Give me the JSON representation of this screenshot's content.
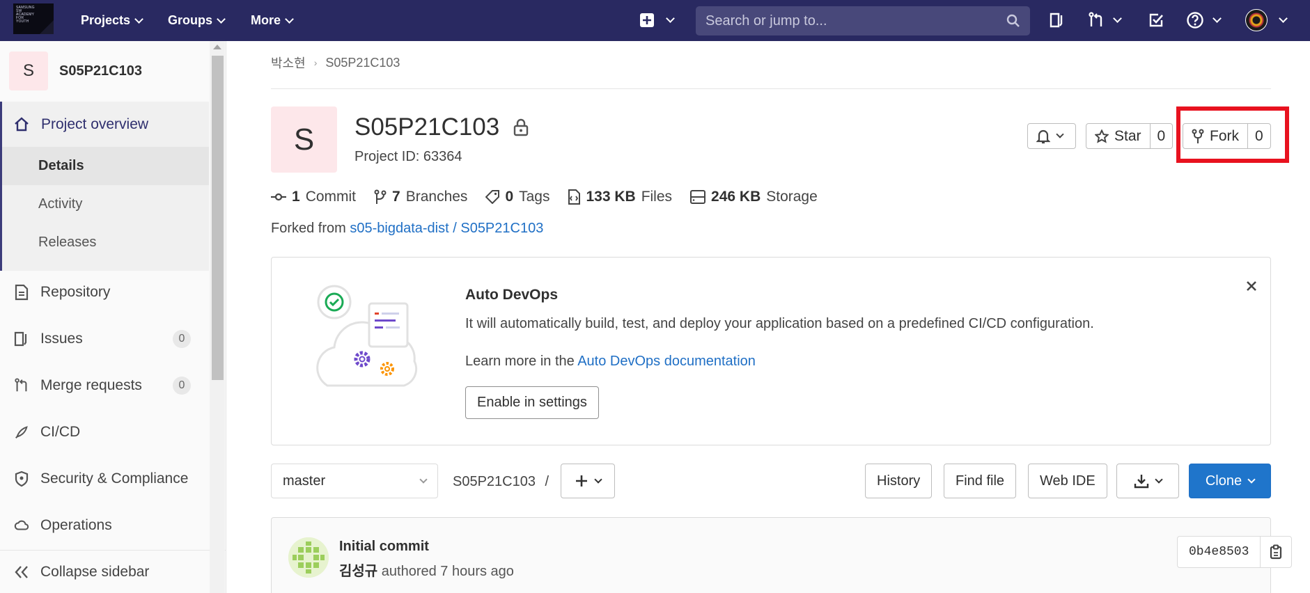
{
  "logo": {
    "lines": [
      "SAMSUNG",
      "SW",
      "ACADEMY",
      "FOR",
      "YOUTH"
    ]
  },
  "topnav": {
    "projects": "Projects",
    "groups": "Groups",
    "more": "More",
    "search_placeholder": "Search or jump to..."
  },
  "sidebar": {
    "project_letter": "S",
    "project_name": "S05P21C103",
    "overview": "Project overview",
    "sub_items": [
      "Details",
      "Activity",
      "Releases"
    ],
    "repository": "Repository",
    "issues": "Issues",
    "issues_count": "0",
    "merge_requests": "Merge requests",
    "merge_requests_count": "0",
    "cicd": "CI/CD",
    "security": "Security & Compliance",
    "operations": "Operations",
    "collapse": "Collapse sidebar"
  },
  "breadcrumb": {
    "user": "박소현",
    "project": "S05P21C103"
  },
  "project": {
    "letter": "S",
    "title": "S05P21C103",
    "id_label": "Project ID: 63364",
    "star_label": "Star",
    "star_count": "0",
    "fork_label": "Fork",
    "fork_count": "0"
  },
  "stats": [
    {
      "value": "1",
      "label": "Commit"
    },
    {
      "value": "7",
      "label": "Branches"
    },
    {
      "value": "0",
      "label": "Tags"
    },
    {
      "value": "133 KB",
      "label": "Files"
    },
    {
      "value": "246 KB",
      "label": "Storage"
    }
  ],
  "forked": {
    "prefix": "Forked from",
    "link": "s05-bigdata-dist / S05P21C103"
  },
  "devops": {
    "title": "Auto DevOps",
    "text": "It will automatically build, test, and deploy your application based on a predefined CI/CD configuration.",
    "learn_prefix": "Learn more in the",
    "learn_link": "Auto DevOps documentation",
    "button": "Enable in settings"
  },
  "repo": {
    "branch": "master",
    "path": "S05P21C103",
    "path_sep": "/",
    "history": "History",
    "find_file": "Find file",
    "web_ide": "Web IDE",
    "clone": "Clone"
  },
  "commit": {
    "title": "Initial commit",
    "author": "김성규",
    "authored": "authored 7 hours ago",
    "sha": "0b4e8503"
  },
  "colors": {
    "navbar": "#292961",
    "primary": "#1f75cb",
    "highlight": "#e8121f",
    "link": "#1f6fc5"
  }
}
